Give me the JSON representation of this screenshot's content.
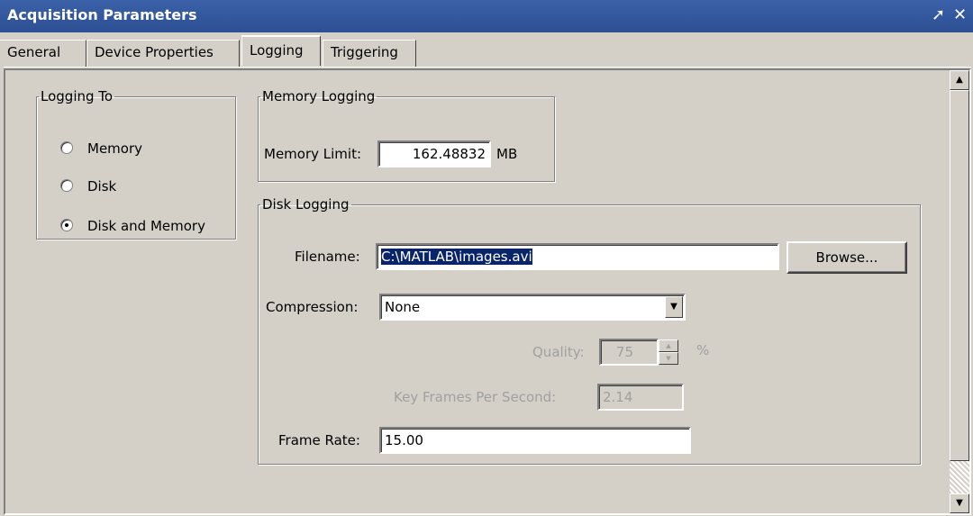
{
  "window": {
    "title": "Acquisition Parameters",
    "pin_glyph": "➚",
    "close_glyph": "✕"
  },
  "tabs": [
    {
      "label": "General"
    },
    {
      "label": "Device Properties"
    },
    {
      "label": "Logging",
      "active": true
    },
    {
      "label": "Triggering"
    }
  ],
  "logging_to": {
    "legend": "Logging To",
    "options": [
      {
        "label": "Memory",
        "checked": false
      },
      {
        "label": "Disk",
        "checked": false
      },
      {
        "label": "Disk and Memory",
        "checked": true
      }
    ]
  },
  "memory_logging": {
    "legend": "Memory Logging",
    "limit_label": "Memory Limit:",
    "limit_value": "162.48832",
    "limit_unit": "MB"
  },
  "disk_logging": {
    "legend": "Disk Logging",
    "filename_label": "Filename:",
    "filename_value": "C:\\MATLAB\\images.avi",
    "browse_label": "Browse...",
    "compression_label": "Compression:",
    "compression_value": "None",
    "quality_label": "Quality:",
    "quality_value": "75",
    "quality_unit": "%",
    "keyframes_label": "Key Frames Per Second:",
    "keyframes_value": "2.14",
    "framerate_label": "Frame Rate:",
    "framerate_value": "15.00"
  },
  "icons": {
    "combo_arrow": "▼",
    "scroll_up": "▲",
    "scroll_down": "▼",
    "spin_up": "▲",
    "spin_down": "▼"
  },
  "colors": {
    "titlebar": "#3b61a8",
    "face": "#d4d0c8",
    "selection": "#0a246a"
  }
}
